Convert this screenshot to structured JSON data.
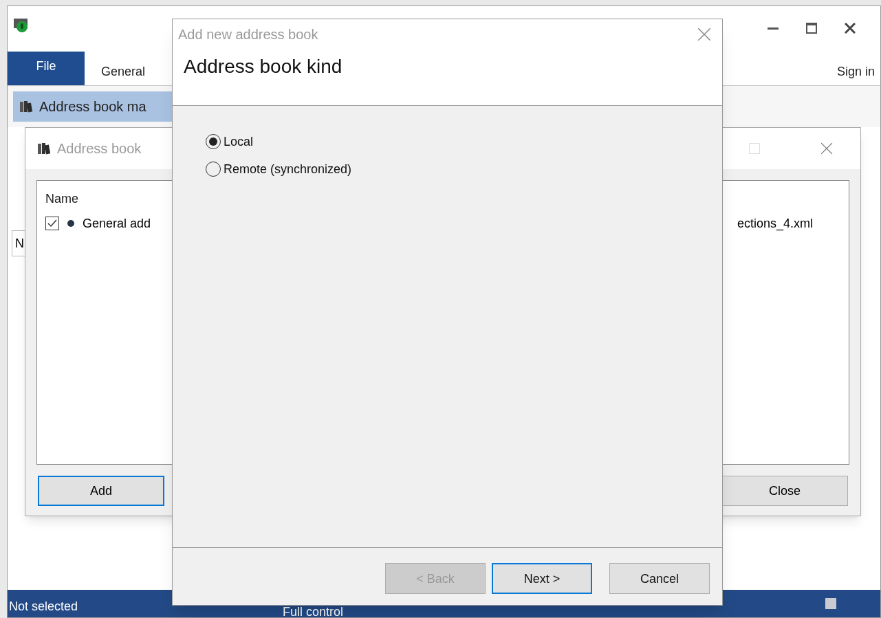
{
  "main_window": {
    "ribbon_tabs": [
      {
        "label": "File",
        "selected": true
      },
      {
        "label": "General",
        "selected": false
      }
    ],
    "sign_in": "Sign in",
    "toolbar_item": {
      "label": "Address book ma",
      "selected": true
    },
    "column_header": "N",
    "status_bar": [
      "Not selected",
      "Full control"
    ]
  },
  "manager_dialog": {
    "title": "Address book",
    "column": "Name",
    "rows": [
      {
        "checked": true,
        "name": "General add",
        "path": "ections_4.xml"
      }
    ],
    "buttons": [
      {
        "label": "Add",
        "focused": true
      },
      {
        "label": "Close",
        "focused": false
      }
    ]
  },
  "wizard": {
    "title": "Add new address book",
    "heading": "Address book kind",
    "options": [
      {
        "label": "Local",
        "selected": true
      },
      {
        "label": "Remote (synchronized)",
        "selected": false
      }
    ],
    "buttons": [
      {
        "label": "< Back",
        "disabled": true,
        "focused": false
      },
      {
        "label": "Next >",
        "disabled": false,
        "focused": true
      },
      {
        "label": "Cancel",
        "disabled": false,
        "focused": false
      }
    ]
  }
}
